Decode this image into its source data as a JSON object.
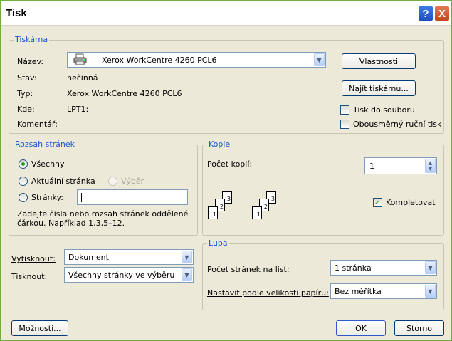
{
  "window": {
    "title": "Tisk",
    "help_glyph": "?",
    "close_glyph": "X"
  },
  "printer": {
    "legend": "Tiskárna",
    "name_label": "Název:",
    "name_value": "Xerox WorkCentre 4260 PCL6",
    "status_label": "Stav:",
    "status_value": "nečinná",
    "type_label": "Typ:",
    "type_value": "Xerox WorkCentre 4260 PCL6",
    "where_label": "Kde:",
    "where_value": "LPT1:",
    "comment_label": "Komentář:",
    "properties_button": "Vlastnosti",
    "find_printer_button": "Najít tiskárnu...",
    "print_to_file_label": "Tisk do souboru",
    "print_to_file_checked": false,
    "manual_duplex_label": "Obousměrný ruční tisk",
    "manual_duplex_checked": false
  },
  "page_range": {
    "legend": "Rozsah stránek",
    "all_label": "Všechny",
    "current_label": "Aktuální stránka",
    "selection_label": "Výběr",
    "pages_label": "Stránky:",
    "pages_value": "",
    "hint": "Zadejte čísla nebo rozsah stránek oddělené čárkou. Například 1,3,5–12.",
    "selected": "all"
  },
  "copies": {
    "legend": "Kopie",
    "count_label": "Počet kopií:",
    "count_value": "1",
    "collate_label": "Kompletovat",
    "collate_checked": true,
    "page_numbers": [
      "1",
      "2",
      "3"
    ]
  },
  "print_what": {
    "label": "Vytisknout:",
    "value": "Dokument"
  },
  "print": {
    "label": "Tisknout:",
    "value": "Všechny stránky ve výběru"
  },
  "zoom": {
    "legend": "Lupa",
    "pages_per_sheet_label": "Počet stránek na list:",
    "pages_per_sheet_value": "1 stránka",
    "scale_label": "Nastavit podle velikosti papíru:",
    "scale_value": "Bez měřítka"
  },
  "buttons": {
    "options": "Možnosti...",
    "ok": "OK",
    "cancel": "Storno"
  },
  "icons": {
    "printer": "printer-icon",
    "dropdown": "chevron-down-icon",
    "spinner": "spinner-icon",
    "checkmark": "checkmark-icon"
  },
  "colors": {
    "legend": "#1656d0",
    "border": "#6db03e",
    "check": "#21a121"
  }
}
